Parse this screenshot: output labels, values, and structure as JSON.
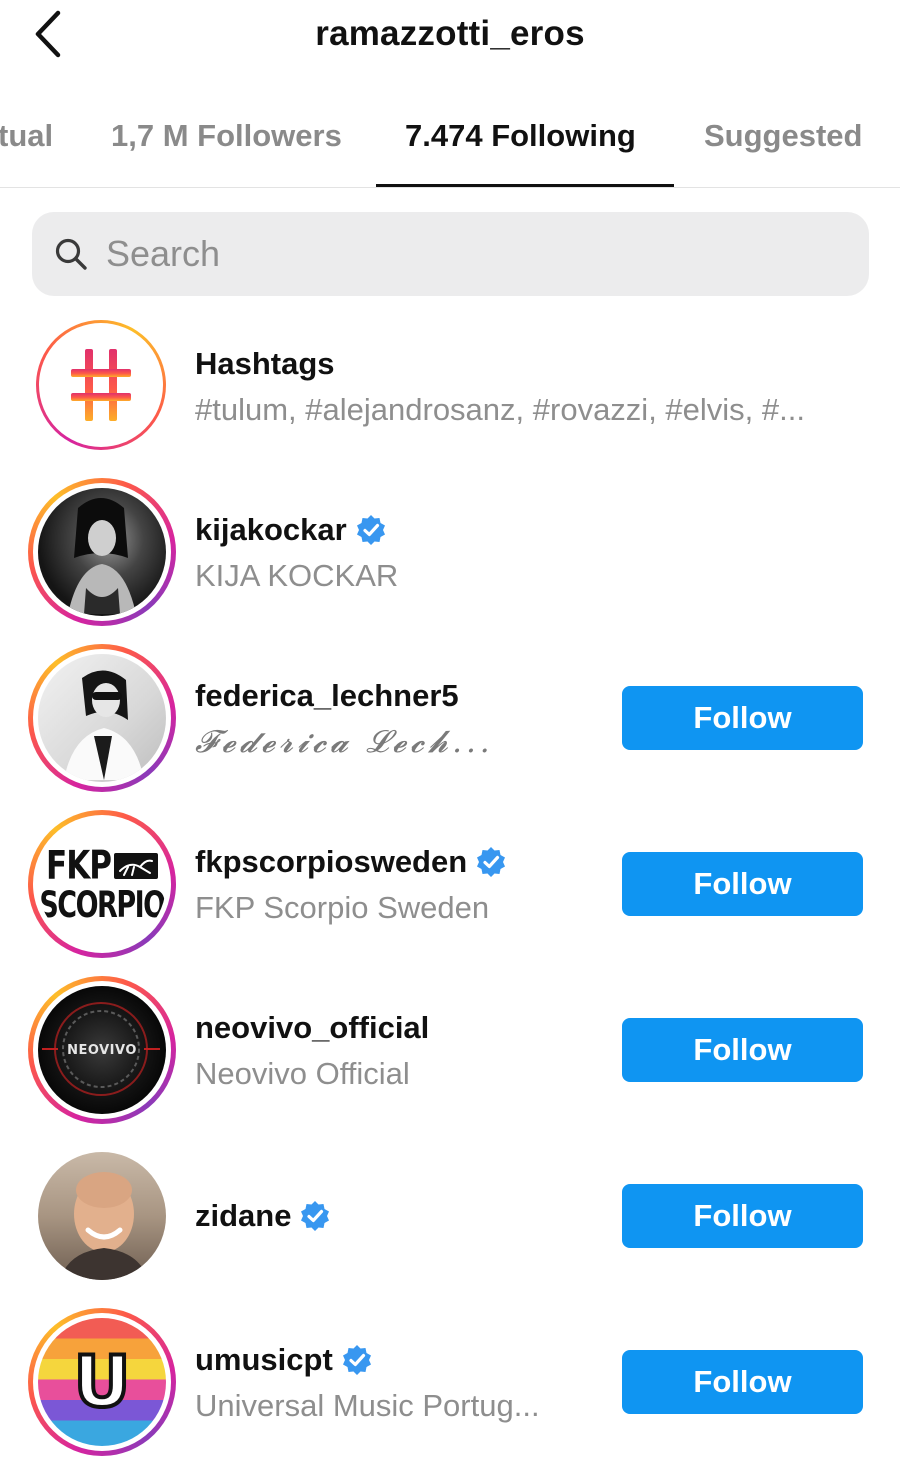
{
  "header": {
    "title": "ramazzotti_eros"
  },
  "tabs": [
    {
      "label": "tual"
    },
    {
      "label": "1,7 M Followers"
    },
    {
      "label": "7.474 Following"
    },
    {
      "label": "Suggested"
    }
  ],
  "search": {
    "placeholder": "Search"
  },
  "hashtags": {
    "title": "Hashtags",
    "subtitle": "#tulum, #alejandrosanz, #rovazzi, #elvis, #..."
  },
  "users": [
    {
      "username": "kijakockar",
      "fullname": "KIJA KOCKAR",
      "verified": true,
      "follow_label": ""
    },
    {
      "username": "federica_lechner5",
      "fullname": "𝓕𝓮𝓭𝓮𝓻𝓲𝓬𝓪 𝓛𝓮𝓬𝓱...",
      "verified": false,
      "follow_label": "Follow"
    },
    {
      "username": "fkpscorpiosweden",
      "fullname": "FKP Scorpio Sweden",
      "verified": true,
      "follow_label": "Follow"
    },
    {
      "username": "neovivo_official",
      "fullname": "Neovivo Official",
      "verified": false,
      "follow_label": "Follow"
    },
    {
      "username": "zidane",
      "fullname": "",
      "verified": true,
      "follow_label": "Follow"
    },
    {
      "username": "umusicpt",
      "fullname": "Universal Music Portug...",
      "verified": true,
      "follow_label": "Follow"
    }
  ],
  "avatar_logos": {
    "fkp_line1": "FKP",
    "fkp_line2": "SCORPIO",
    "neovivo": "NEOVIVO",
    "umusic": "U"
  },
  "colors": {
    "follow_button": "#0f95f2",
    "verified_badge": "#3897f0",
    "secondary_text": "#8e8e8e",
    "search_bg": "#ececed"
  }
}
